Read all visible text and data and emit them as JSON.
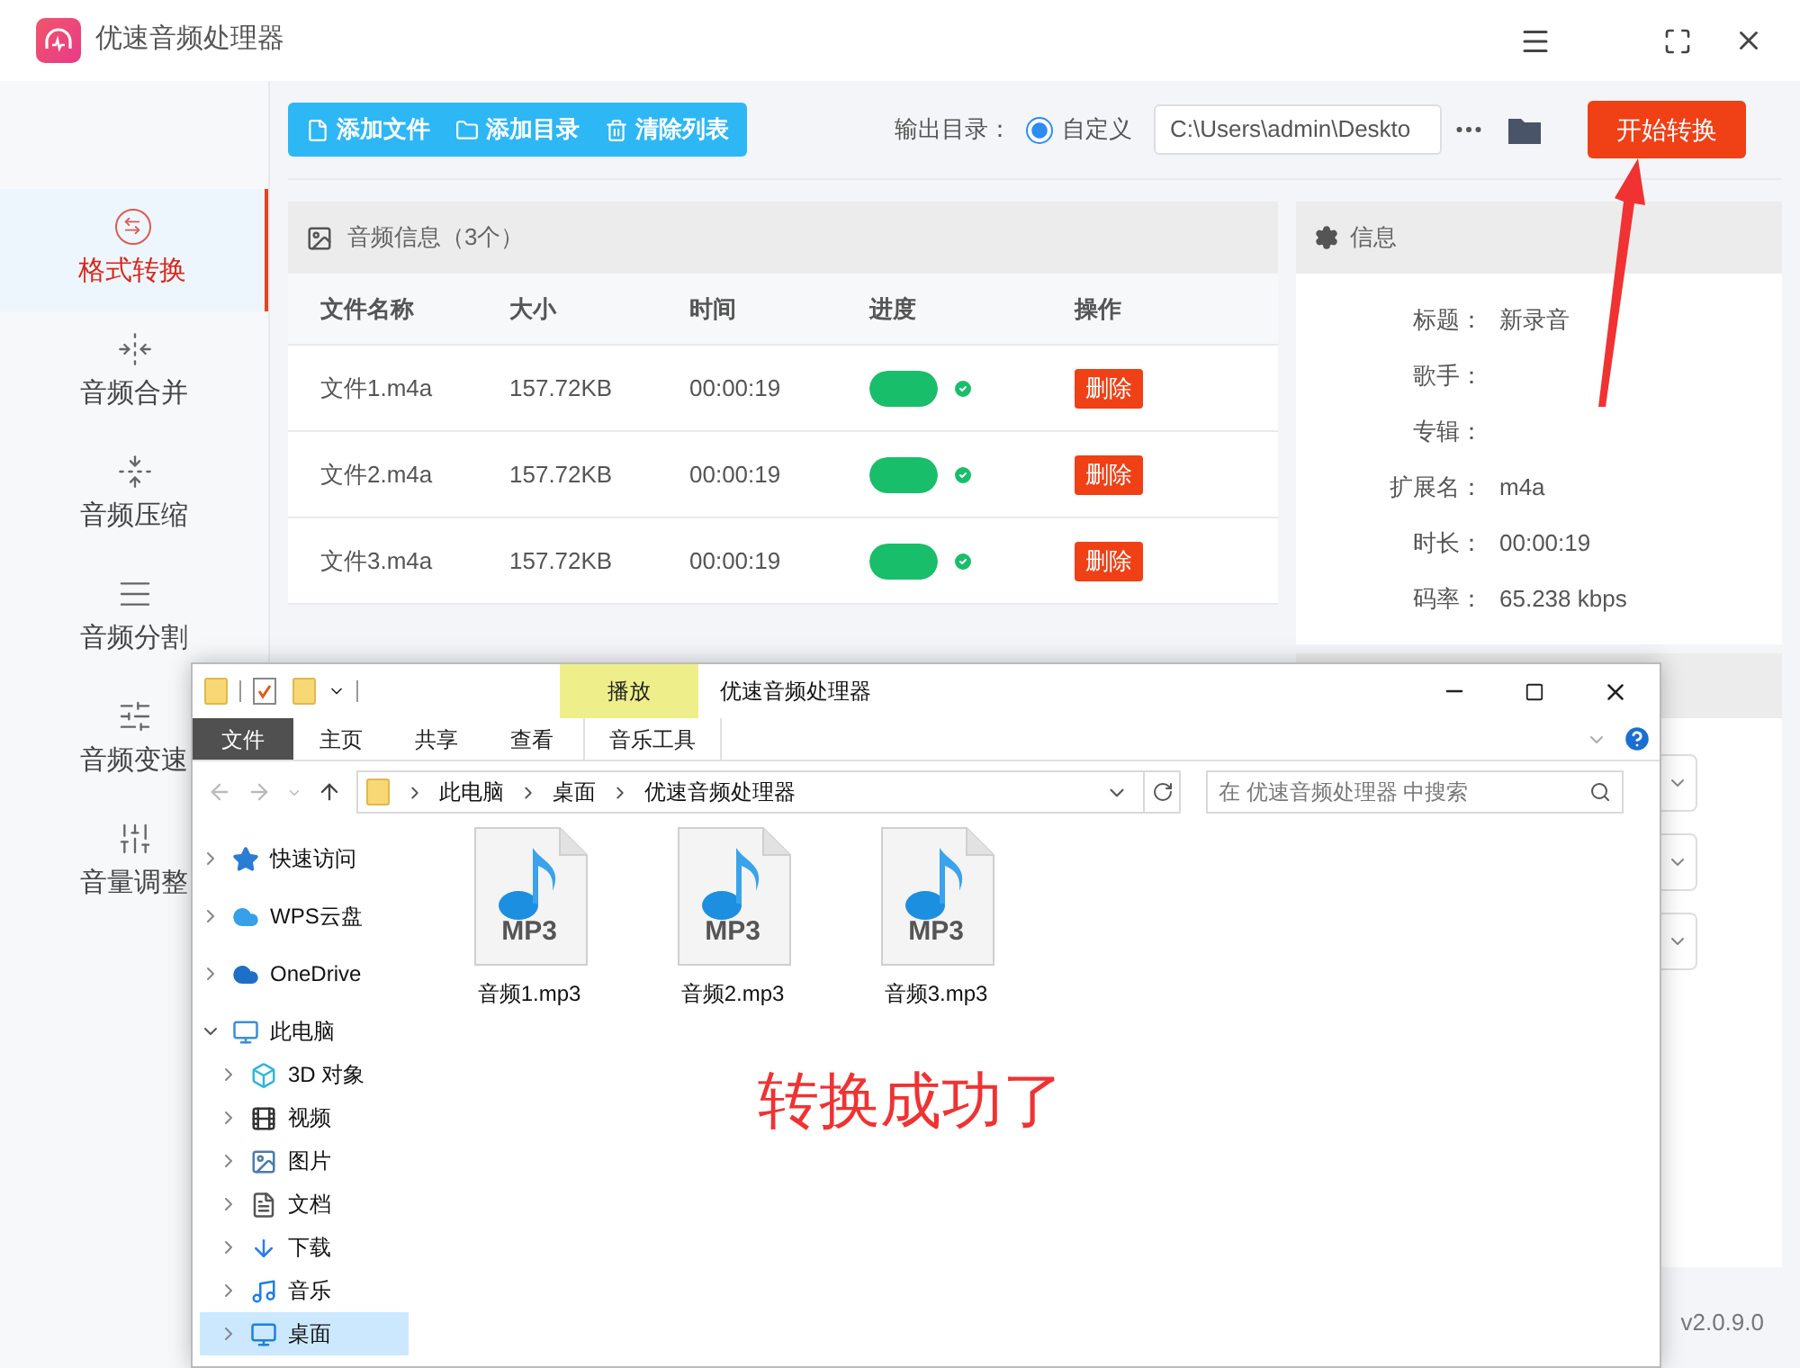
{
  "app": {
    "title": "优速音频处理器"
  },
  "sidebar": {
    "items": [
      {
        "label": "格式转换",
        "selected": true
      },
      {
        "label": "音频合并",
        "selected": false
      },
      {
        "label": "音频压缩",
        "selected": false
      },
      {
        "label": "音频分割",
        "selected": false
      },
      {
        "label": "音频变速",
        "selected": false
      },
      {
        "label": "音量调整",
        "selected": false
      }
    ]
  },
  "toolbar": {
    "buttons": [
      "添加文件",
      "添加目录",
      "清除列表"
    ],
    "output_label": "输出目录：",
    "output_option": {
      "label": "自定义",
      "selected": true
    },
    "output_path": "C:\\Users\\admin\\Deskto",
    "start_button": "开始转换"
  },
  "file_list": {
    "title": "音频信息（3个）",
    "columns": [
      "文件名称",
      "大小",
      "时间",
      "进度",
      "操作"
    ],
    "rows": [
      {
        "name": "文件1.m4a",
        "size": "157.72KB",
        "time": "00:00:19",
        "level": 1,
        "done": true,
        "action": "删除"
      },
      {
        "name": "文件2.m4a",
        "size": "157.72KB",
        "time": "00:00:19",
        "level": 1,
        "done": true,
        "action": "删除"
      },
      {
        "name": "文件3.m4a",
        "size": "157.72KB",
        "time": "00:00:19",
        "level": 1,
        "done": true,
        "action": "删除"
      }
    ]
  },
  "info": {
    "title": "信息",
    "fields": [
      {
        "label": "标题：",
        "value": "新录音"
      },
      {
        "label": "歌手："
      },
      {
        "label": "专辑："
      },
      {
        "label": "扩展名：",
        "value": "m4a"
      },
      {
        "label": "时长：",
        "value": "00:00:19"
      },
      {
        "label": "码率：",
        "value": "65.238 kbps"
      }
    ]
  },
  "version": "v2.0.9.0",
  "explorer": {
    "title": "优速音频处理器",
    "context_tab": "播放",
    "ribbon_tabs": [
      {
        "label": "文件",
        "kind": "file"
      },
      {
        "label": "主页",
        "kind": "plain"
      },
      {
        "label": "共享",
        "kind": "plain"
      },
      {
        "label": "查看",
        "kind": "plain"
      },
      {
        "label": "音乐工具",
        "kind": "context"
      }
    ],
    "path": [
      "此电脑",
      "桌面",
      "优速音频处理器"
    ],
    "search_placeholder": "在 优速音频处理器 中搜索",
    "nav": [
      {
        "label": "快速访问",
        "kind": "star",
        "expanded": false,
        "selected": false
      },
      {
        "label": "WPS云盘",
        "kind": "cloud",
        "expanded": false,
        "selected": false
      },
      {
        "label": "OneDrive",
        "kind": "onedrive",
        "expanded": false,
        "selected": false
      },
      {
        "label": "此电脑",
        "kind": "pc",
        "expanded": true,
        "selected": false,
        "children": [
          {
            "label": "3D 对象",
            "kind": "cube",
            "expanded": false,
            "selected": false
          },
          {
            "label": "视频",
            "kind": "video",
            "expanded": false,
            "selected": false
          },
          {
            "label": "图片",
            "kind": "image",
            "expanded": false,
            "selected": false
          },
          {
            "label": "文档",
            "kind": "doc",
            "expanded": false,
            "selected": false
          },
          {
            "label": "下载",
            "kind": "download",
            "expanded": false,
            "selected": false
          },
          {
            "label": "音乐",
            "kind": "music",
            "expanded": false,
            "selected": false
          },
          {
            "label": "桌面",
            "kind": "desktop",
            "expanded": false,
            "selected": true
          }
        ]
      }
    ],
    "files": [
      {
        "name": "音频1.mp3",
        "badge": "MP3"
      },
      {
        "name": "音频2.mp3",
        "badge": "MP3"
      },
      {
        "name": "音频3.mp3",
        "badge": "MP3"
      }
    ]
  },
  "annotation": {
    "text": "转换成功了"
  }
}
